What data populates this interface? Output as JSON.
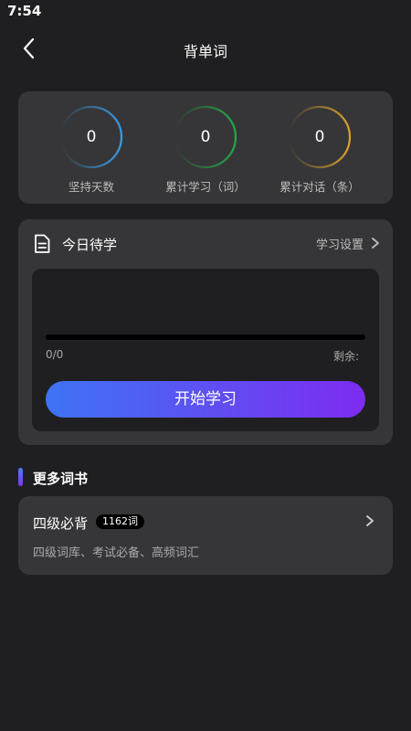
{
  "status_bar": {
    "time": "7:54"
  },
  "nav": {
    "title": "背单词",
    "back_icon": "chevron-left-icon"
  },
  "stats": [
    {
      "value": "0",
      "label": "坚持天数",
      "color": "#3a9be6"
    },
    {
      "value": "0",
      "label": "累计学习（词）",
      "color": "#27a845"
    },
    {
      "value": "0",
      "label": "累计对话（条）",
      "color": "#d9a22e"
    }
  ],
  "today": {
    "icon": "document-icon",
    "title": "今日待学",
    "settings_label": "学习设置",
    "progress_text": "0/0",
    "progress_fraction": 0,
    "remaining_label": "剩余:",
    "start_button": "开始学习"
  },
  "more_books": {
    "section_title": "更多词书",
    "books": [
      {
        "title": "四级必背",
        "badge": "1162词",
        "description": "四级词库、考试必备、高频词汇"
      }
    ]
  },
  "colors": {
    "background": "#1f1f21",
    "card": "#363638",
    "button_gradient_start": "#3e74f5",
    "button_gradient_end": "#7d2cf0"
  }
}
